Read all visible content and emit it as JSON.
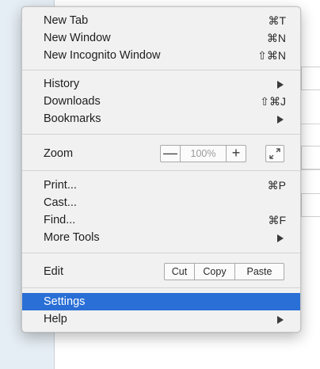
{
  "menu": {
    "items": {
      "new_tab": {
        "label": "New Tab",
        "shortcut": "⌘T"
      },
      "new_window": {
        "label": "New Window",
        "shortcut": "⌘N"
      },
      "new_incognito": {
        "label": "New Incognito Window",
        "shortcut": "⇧⌘N"
      },
      "history": {
        "label": "History"
      },
      "downloads": {
        "label": "Downloads",
        "shortcut": "⇧⌘J"
      },
      "bookmarks": {
        "label": "Bookmarks"
      },
      "zoom": {
        "label": "Zoom",
        "minus": "—",
        "value": "100%",
        "plus": "+"
      },
      "print": {
        "label": "Print...",
        "shortcut": "⌘P"
      },
      "cast": {
        "label": "Cast..."
      },
      "find": {
        "label": "Find...",
        "shortcut": "⌘F"
      },
      "more_tools": {
        "label": "More Tools"
      },
      "edit": {
        "label": "Edit",
        "cut": "Cut",
        "copy": "Copy",
        "paste": "Paste"
      },
      "settings": {
        "label": "Settings"
      },
      "help": {
        "label": "Help"
      }
    },
    "selected_item": "Settings",
    "highlight_color": "#2a6fd6"
  },
  "icons": {
    "submenu_arrow": "submenu-arrow-icon",
    "fullscreen": "fullscreen-icon"
  }
}
